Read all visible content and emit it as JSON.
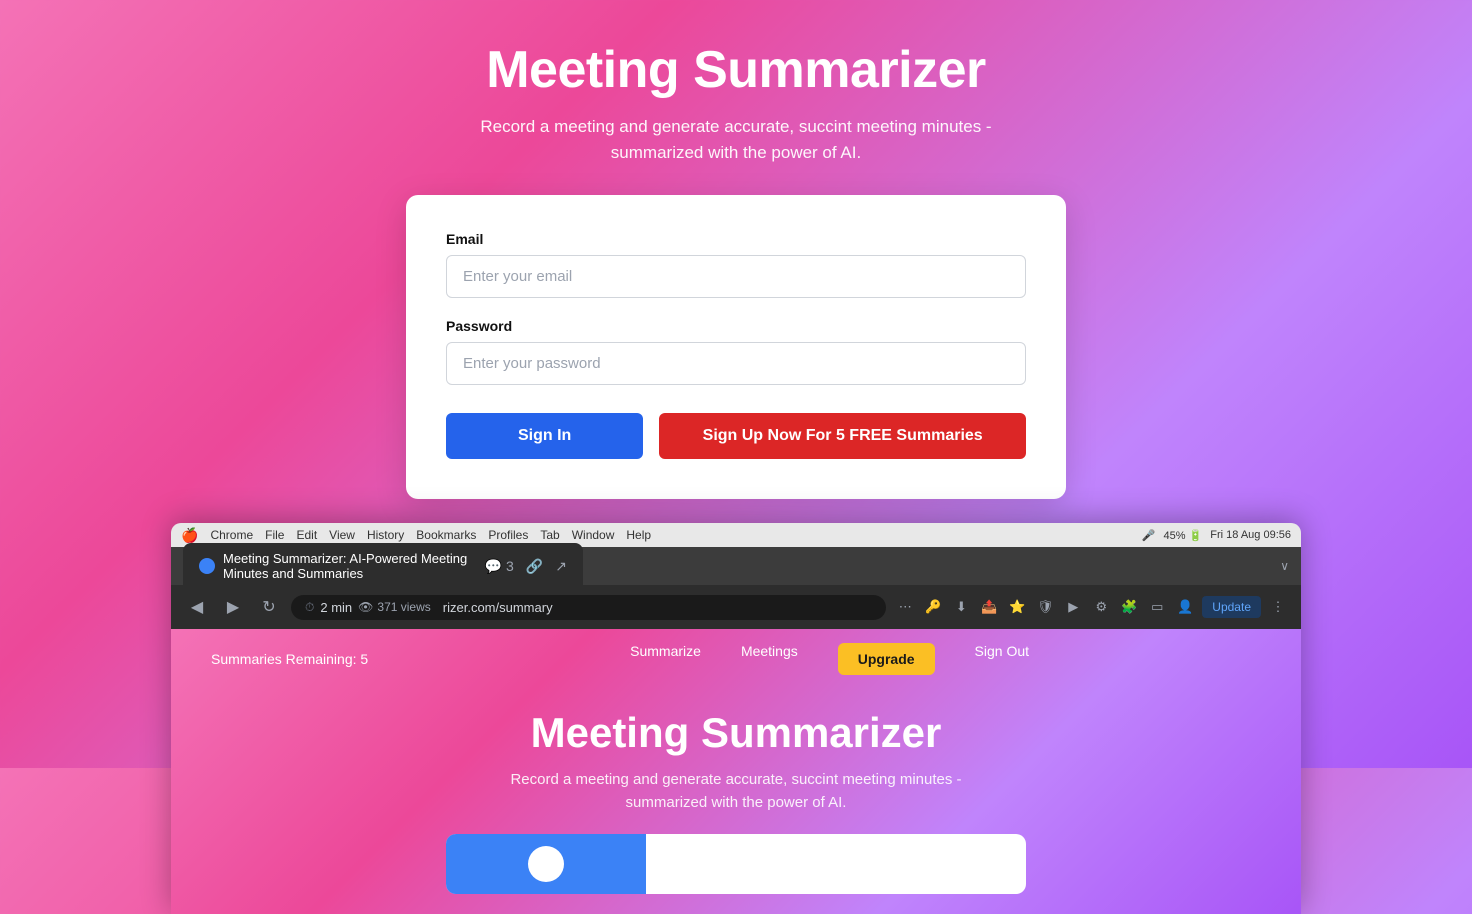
{
  "page": {
    "title": "Meeting Summarizer",
    "subtitle": "Record a meeting and generate accurate, succint meeting minutes -\nsummarized with the power of AI."
  },
  "form": {
    "email_label": "Email",
    "email_placeholder": "Enter your email",
    "password_label": "Password",
    "password_placeholder": "Enter your password",
    "signin_button": "Sign In",
    "signup_button": "Sign Up Now For 5 FREE Summaries"
  },
  "browser": {
    "tab_title": "Meeting Summarizer: AI-Powered Meeting Minutes and Summaries",
    "comment_count": "3",
    "read_time": "2 min",
    "view_count": "371 views",
    "address": "rizer.com/summary",
    "update_label": "Update",
    "menubar": {
      "apple": "🍎",
      "items": [
        "Chrome",
        "File",
        "Edit",
        "View",
        "History",
        "Bookmarks",
        "Profiles",
        "Tab",
        "Window",
        "Help"
      ],
      "right": "Fri 18 Aug  09:56"
    }
  },
  "inner_page": {
    "nav": {
      "summaries_remaining": "Summaries Remaining: 5",
      "summarize": "Summarize",
      "meetings": "Meetings",
      "upgrade": "Upgrade",
      "signout": "Sign Out"
    },
    "title": "Meeting Summarizer",
    "subtitle": "Record a meeting and generate accurate, succint meeting minutes -\nsummarized with the power of AI."
  }
}
